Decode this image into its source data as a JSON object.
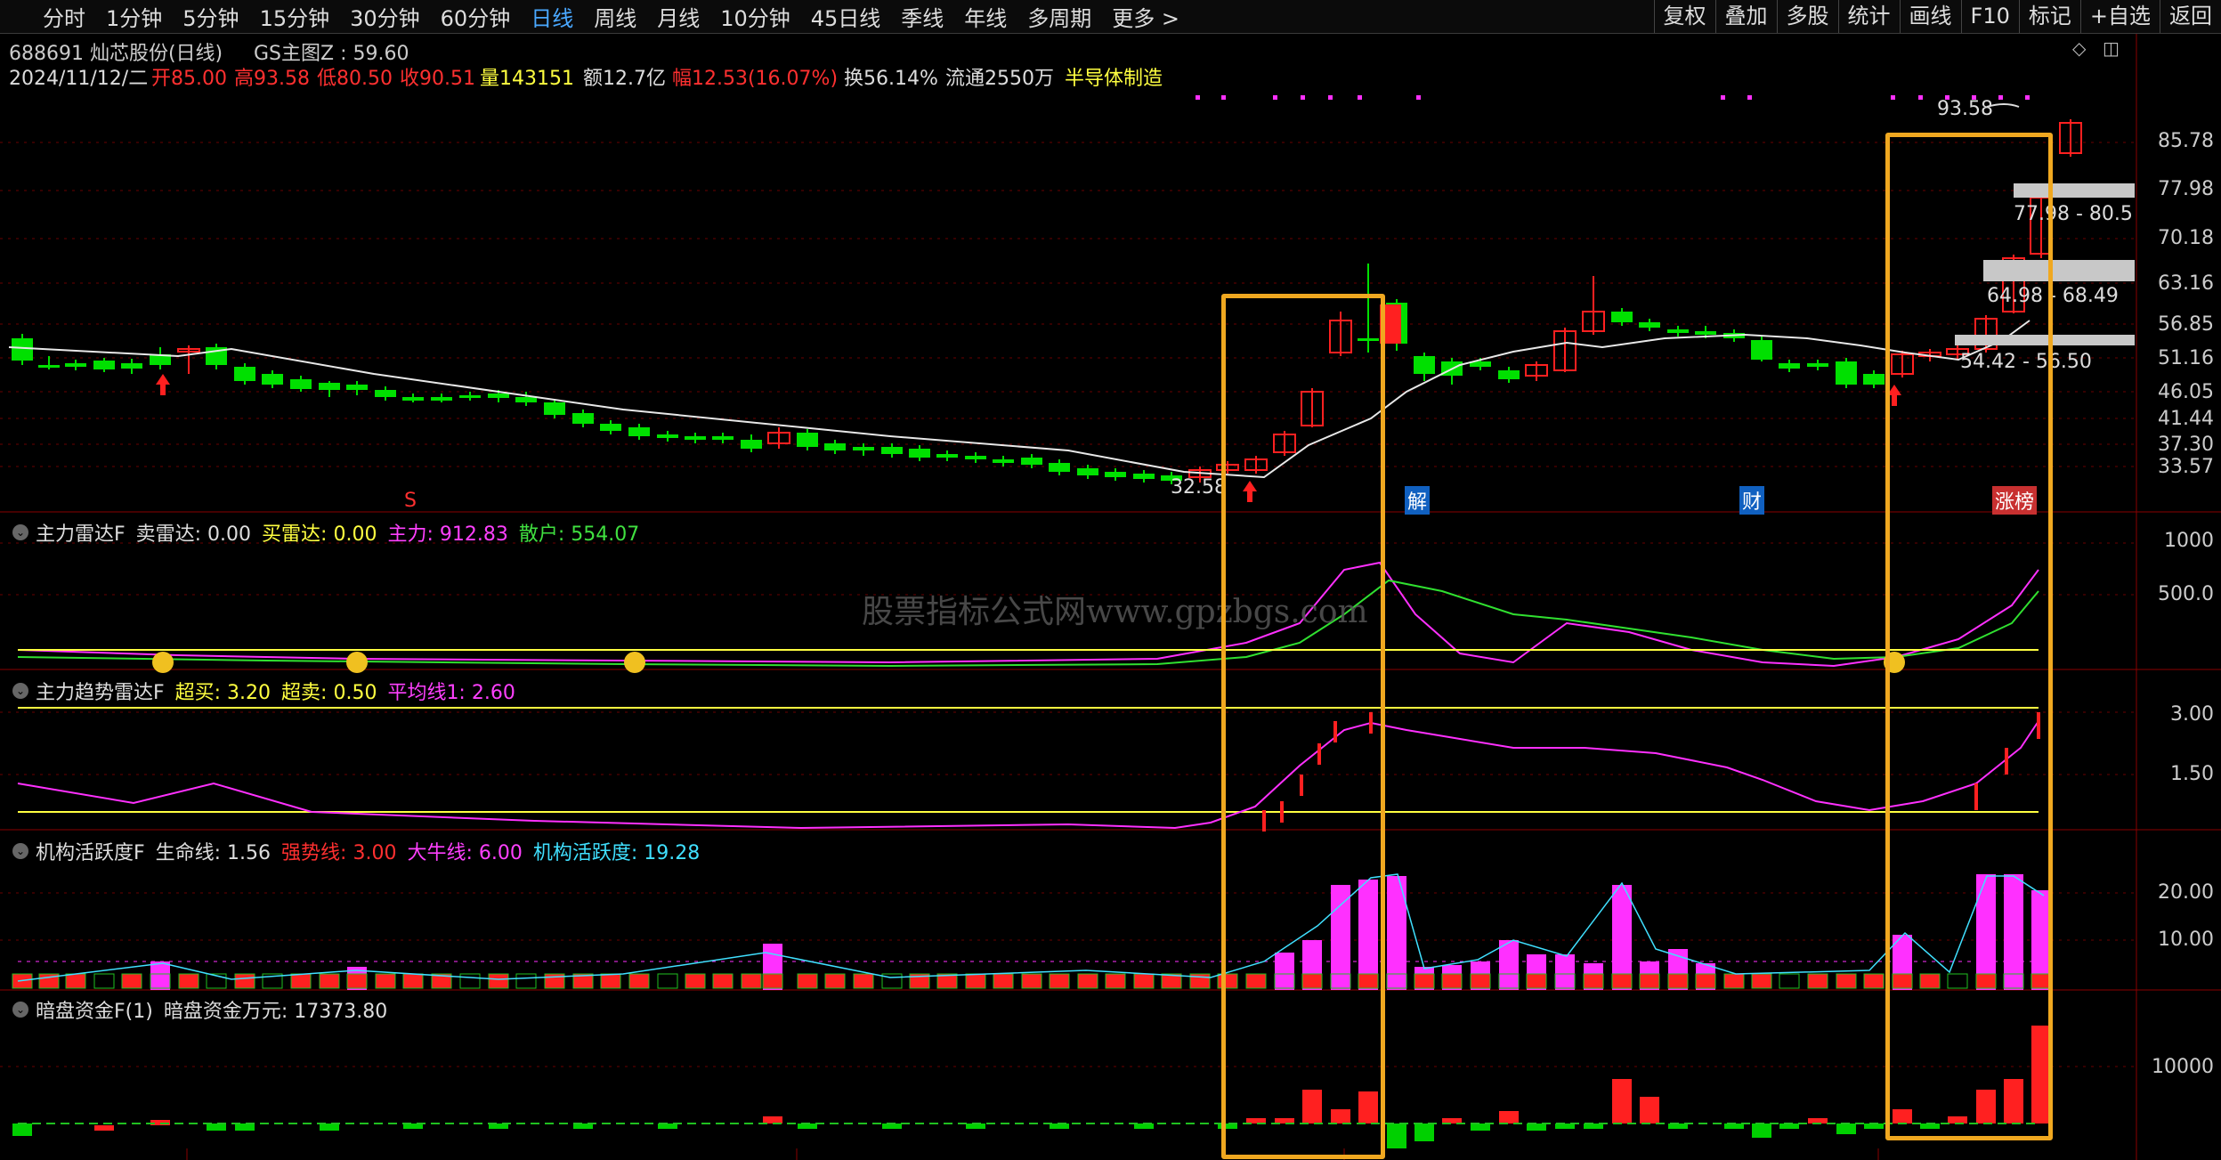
{
  "toolbar": {
    "periods": [
      "分时",
      "1分钟",
      "5分钟",
      "15分钟",
      "30分钟",
      "60分钟",
      "日线",
      "周线",
      "月线",
      "10分钟",
      "45日线",
      "季线",
      "年线",
      "多周期",
      "更多 >"
    ],
    "active_period": "日线",
    "right_buttons": [
      "复权",
      "叠加",
      "多股",
      "统计",
      "画线",
      "F10",
      "标记",
      "+自选",
      "返回"
    ]
  },
  "stock": {
    "code_name": "688691 灿芯股份(日线)",
    "indicator": "GS主图Z : 59.60",
    "date": "2024/11/12/二",
    "open": "开85.00",
    "high": "高93.58",
    "low": "低80.50",
    "close": "收90.51",
    "volume": "量143151",
    "amount": "额12.7亿",
    "change": "幅12.53(16.07%)",
    "turnover": "换56.14%",
    "float": "流通2550万",
    "sector": "半导体制造"
  },
  "main_chart": {
    "y_ticks": [
      "85.78",
      "77.98",
      "70.18",
      "63.16",
      "56.85",
      "51.16",
      "46.05",
      "41.44",
      "37.30",
      "33.57"
    ],
    "high_label": "93.58",
    "low_label": "32.58",
    "zones": [
      "77.98 - 80.5",
      "64.98 - 68.49",
      "54.42 - 56.50"
    ],
    "markers": {
      "s": "S",
      "jie": "解",
      "cai": "财",
      "zhangbang": "涨榜"
    }
  },
  "panel1": {
    "title": "主力雷达F",
    "items": [
      "卖雷达: 0.00",
      "买雷达: 0.00",
      "主力: 912.83",
      "散户: 554.07"
    ],
    "y_ticks": [
      "1000",
      "500.0"
    ]
  },
  "panel2": {
    "title": "主力趋势雷达F",
    "items": [
      "超买: 3.20",
      "超卖: 0.50",
      "平均线1: 2.60"
    ],
    "y_ticks": [
      "3.00",
      "1.50"
    ]
  },
  "panel3": {
    "title": "机构活跃度F",
    "items": [
      "生命线: 1.56",
      "强势线: 3.00",
      "大牛线: 6.00",
      "机构活跃度: 19.28"
    ],
    "y_ticks": [
      "20.00",
      "10.00"
    ]
  },
  "panel4": {
    "title": "暗盘资金F(1)",
    "items": [
      "暗盘资金万元: 17373.80"
    ],
    "y_ticks": [
      "10000"
    ]
  },
  "watermark": "股票指标公式网www.gpzbgs.com",
  "colors": {
    "up": "#ff2020",
    "down": "#00e000",
    "highlight": "#f0a820",
    "ma": "#e8e8e8",
    "magenta": "#ff30ff",
    "cyan": "#40e0ff",
    "yellow": "#ffff40"
  }
}
